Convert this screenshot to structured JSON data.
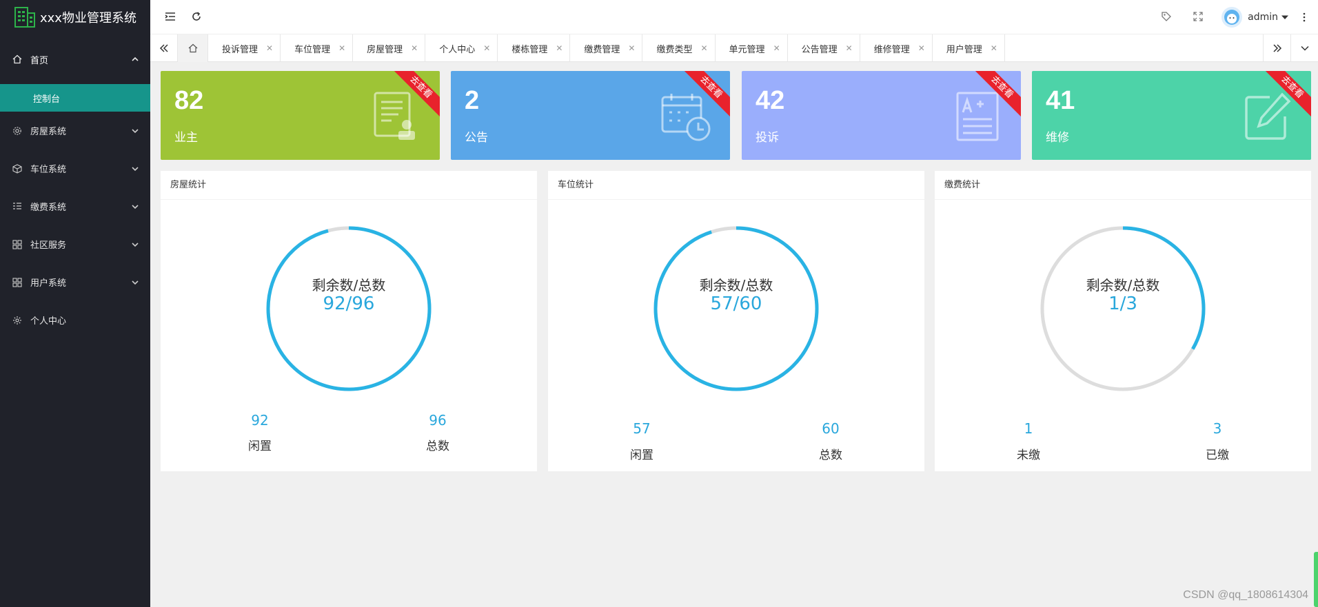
{
  "app": {
    "title": "xxx物业管理系统"
  },
  "sidebar": {
    "home": {
      "label": "首页",
      "sub": "控制台"
    },
    "items": [
      {
        "label": "房屋系统",
        "icon": "gear-icon"
      },
      {
        "label": "车位系统",
        "icon": "cube-icon"
      },
      {
        "label": "缴费系统",
        "icon": "list-icon"
      },
      {
        "label": "社区服务",
        "icon": "grid-icon"
      },
      {
        "label": "用户系统",
        "icon": "grid-icon"
      },
      {
        "label": "个人中心",
        "icon": "settings-icon"
      }
    ]
  },
  "header": {
    "username": "admin"
  },
  "tabs": [
    "投诉管理",
    "车位管理",
    "房屋管理",
    "个人中心",
    "楼栋管理",
    "缴费管理",
    "缴费类型",
    "单元管理",
    "公告管理",
    "维修管理",
    "用户管理"
  ],
  "cards": [
    {
      "value": "82",
      "label": "业主",
      "ribbon": "去查看",
      "color": "#9ec436"
    },
    {
      "value": "2",
      "label": "公告",
      "ribbon": "去查看",
      "color": "#5aa6e8"
    },
    {
      "value": "42",
      "label": "投诉",
      "ribbon": "去查看",
      "color": "#9aaefc"
    },
    {
      "value": "41",
      "label": "维修",
      "ribbon": "去查看",
      "color": "#4dd3a8"
    }
  ],
  "panels": [
    {
      "title": "房屋统计",
      "center_label": "剩余数/总数",
      "center_value": "92/96",
      "left_num": "92",
      "left_label": "闲置",
      "right_num": "96",
      "right_label": "总数",
      "fraction": 0.9583
    },
    {
      "title": "车位统计",
      "center_label": "剩余数/总数",
      "center_value": "57/60",
      "left_num": "57",
      "left_label": "闲置",
      "right_num": "60",
      "right_label": "总数",
      "fraction": 0.95
    },
    {
      "title": "缴费统计",
      "center_label": "剩余数/总数",
      "center_value": "1/3",
      "left_num": "1",
      "left_label": "未缴",
      "right_num": "3",
      "right_label": "已缴",
      "fraction": 0.3333
    }
  ],
  "colors": {
    "ring": "#29b3e4",
    "ring_track": "#dddddd",
    "sidebar_bg": "#20222a",
    "active_sub": "#16958b",
    "ribbon": "#e8222c"
  },
  "watermark": "CSDN @qq_1808614304"
}
